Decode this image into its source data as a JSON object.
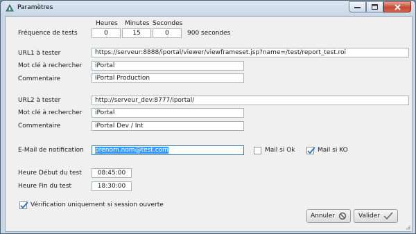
{
  "window": {
    "title": "Paramètres"
  },
  "frequency": {
    "label": "Fréquence de tests",
    "headers": {
      "hours": "Heures",
      "minutes": "Minutes",
      "seconds": "Secondes"
    },
    "hours": "0",
    "minutes": "15",
    "seconds": "0",
    "total": "900 secondes"
  },
  "url1": {
    "url_label": "URL1 à tester",
    "url": "https://serveur:8888/iportal/viewer/viewframeset.jsp?name=/test/report_test.roi",
    "keyword_label": "Mot clé à rechercher",
    "keyword": "iPortal",
    "comment_label": "Commentaire",
    "comment": "iPortal Production"
  },
  "url2": {
    "url_label": "URL2 à tester",
    "url": "http://serveur_dev:8777/iportal/",
    "keyword_label": "Mot clé à rechercher",
    "keyword": "iPortal",
    "comment_label": "Commentaire",
    "comment": "iPortal Dev / Int"
  },
  "email": {
    "label": "E-Mail de notification",
    "value": "prenom.nom@test.com",
    "mail_ok_label": "Mail si Ok",
    "mail_ok_checked": false,
    "mail_ko_label": "Mail si KO",
    "mail_ko_checked": true
  },
  "schedule": {
    "start_label": "Heure Début du test",
    "start": "08:45:00",
    "end_label": "Heure Fin du test",
    "end": "18:30:00"
  },
  "session_check": {
    "label": "Vérification uniquement si session ouverte",
    "checked": true
  },
  "buttons": {
    "cancel": "Annuler",
    "validate": "Valider"
  },
  "colors": {
    "accent": "#3399ff",
    "check": "#2a6fd6",
    "close_button": "#c44a31"
  }
}
